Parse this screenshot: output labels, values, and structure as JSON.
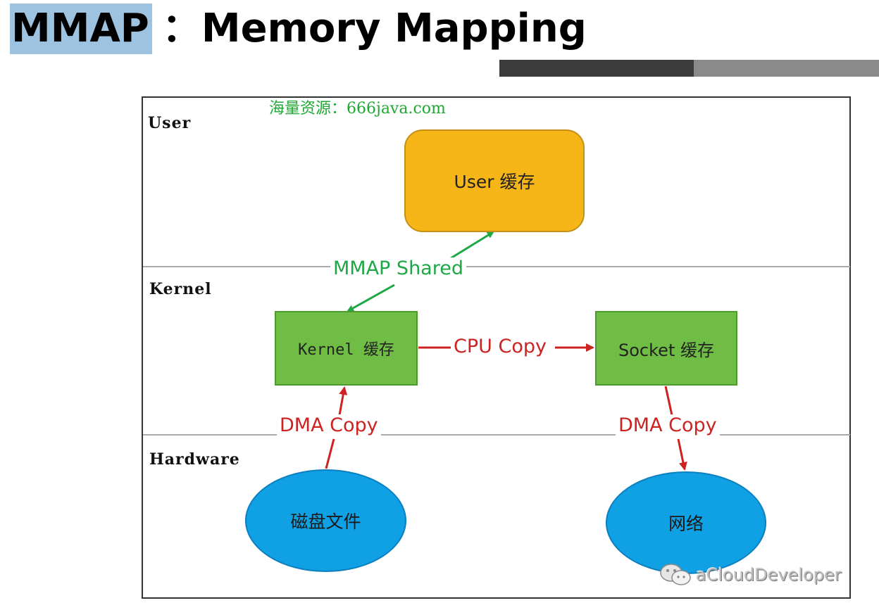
{
  "slide": {
    "title_highlight": "MMAP",
    "title_rest": "：Memory Mapping"
  },
  "watermark": "海量资源：666java.com",
  "zones": {
    "user": "User",
    "kernel": "Kernel",
    "hardware": "Hardware"
  },
  "nodes": {
    "user_cache": "User 缓存",
    "kernel_cache": "Kernel 缓存",
    "socket_cache": "Socket 缓存",
    "disk_file": "磁盘文件",
    "network": "网络"
  },
  "connections": {
    "mmap_shared": "MMAP Shared",
    "cpu_copy": "CPU Copy",
    "dma_copy_left": "DMA Copy",
    "dma_copy_right": "DMA Copy"
  },
  "brand": "aCloudDeveloper",
  "icons": {
    "brand": "wechat-icon"
  },
  "colors": {
    "title_highlight": "#9dc3e0",
    "user_box": "#f6b618",
    "kernel_box": "#6fbd45",
    "ellipse": "#10a0e4",
    "green_arrow": "#1ea845",
    "red_arrow": "#cc2222",
    "watermark": "#1ea832"
  }
}
